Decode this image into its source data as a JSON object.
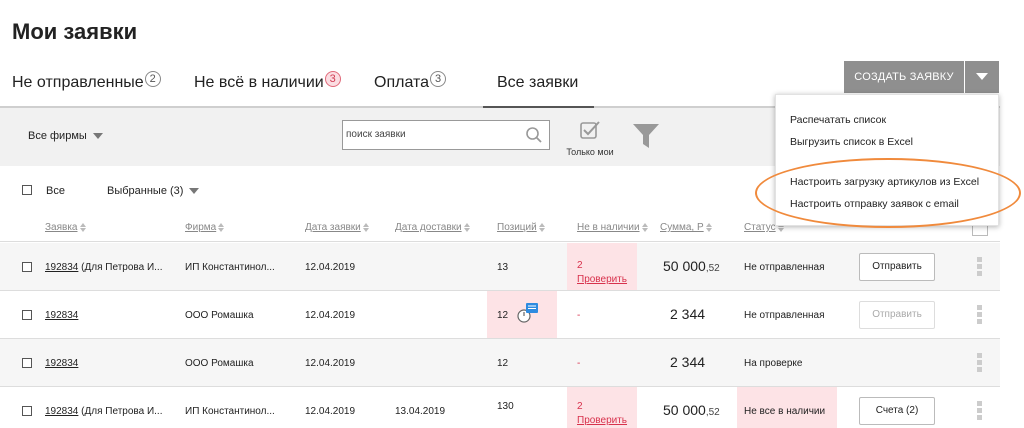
{
  "page": {
    "title": "Мои заявки"
  },
  "tabs": [
    {
      "label": "Не отправленные",
      "badge": "2"
    },
    {
      "label": "Не всё в наличии",
      "badge": "3"
    },
    {
      "label": "Оплата",
      "badge": "3"
    },
    {
      "label": "Все заявки",
      "badge": ""
    }
  ],
  "create_button": {
    "label": "СОЗДАТЬ ЗАЯВКУ"
  },
  "menu": {
    "items": [
      "Распечатать список",
      "Выгрузить список в Excel",
      "Настроить загрузку артикулов из Excel",
      "Настроить отправку заявок с email"
    ]
  },
  "filters": {
    "firm": "Все фирмы",
    "search_placeholder": "поиск заявки",
    "only_mine": "Только мои"
  },
  "selection": {
    "all_label": "Все",
    "selected_label": "Выбранные (3)"
  },
  "columns": [
    "Заявка",
    "Фирма",
    "Дата заявки",
    "Дата доставки",
    "Позиций",
    "Не в наличии",
    "Сумма, Р",
    "Статус"
  ],
  "rows": [
    {
      "id": "192834",
      "note": " (Для Петрова И...",
      "firm": "ИП Константинол...",
      "date": "12.04.2019",
      "delivery": "",
      "positions": "13",
      "missing": "2",
      "missing_link": "Проверить",
      "sum_main": "50 000",
      "sum_cents": ",52",
      "status": "Не отправленная",
      "action": "Отправить"
    },
    {
      "id": "192834",
      "note": "",
      "firm": "ООО Ромашка",
      "date": "12.04.2019",
      "delivery": "",
      "positions": "12",
      "missing": "-",
      "missing_link": "",
      "sum_main": "2 344",
      "sum_cents": "",
      "status": "Не отправленная",
      "action": "Отправить"
    },
    {
      "id": "192834",
      "note": "",
      "firm": "ООО Ромашка",
      "date": "12.04.2019",
      "delivery": "",
      "positions": "12",
      "missing": "-",
      "missing_link": "",
      "sum_main": "2 344",
      "sum_cents": "",
      "status": "На проверке",
      "action": ""
    },
    {
      "id": "192834",
      "note": " (Для Петрова И...",
      "firm": "ИП Константинол...",
      "date": "12.04.2019",
      "delivery": "13.04.2019",
      "positions": "130",
      "missing": "2",
      "missing_link": "Проверить",
      "sum_main": "50 000",
      "sum_cents": ",52",
      "status": "Не все в наличии",
      "action": "Счета (2)"
    }
  ],
  "colors": {
    "accent_gray": "#8f8f8f",
    "missing_bg": "#fde3e6",
    "alert_red": "#d8314c",
    "highlight_orange": "#f08a3c"
  }
}
